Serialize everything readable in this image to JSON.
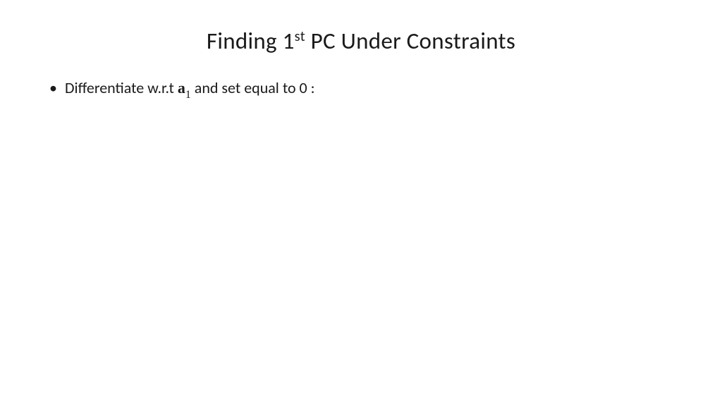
{
  "title": {
    "prefix": "Finding 1",
    "superscript": "st",
    "suffix": " PC Under Constraints"
  },
  "bullet": {
    "text_before": "Differentiate w.r.t ",
    "variable": "a",
    "subscript": "1",
    "text_after": " and set equal to 0 :"
  }
}
